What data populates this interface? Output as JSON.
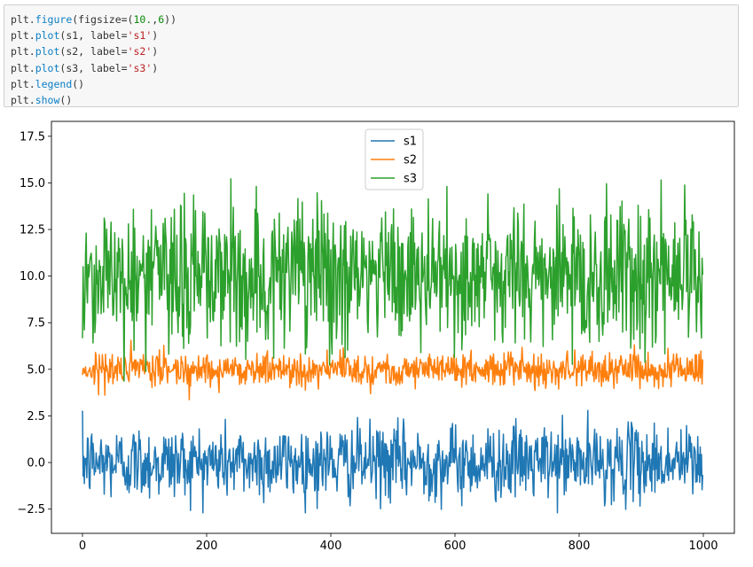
{
  "code_cell": {
    "lines": [
      [
        {
          "t": "plt.",
          "c": "plain"
        },
        {
          "t": "figure",
          "c": "fn"
        },
        {
          "t": "(figsize=(",
          "c": "plain"
        },
        {
          "t": "10.",
          "c": "num"
        },
        {
          "t": ",",
          "c": "plain"
        },
        {
          "t": "6",
          "c": "num"
        },
        {
          "t": "))",
          "c": "plain"
        }
      ],
      [
        {
          "t": "plt.",
          "c": "plain"
        },
        {
          "t": "plot",
          "c": "fn"
        },
        {
          "t": "(s1, label=",
          "c": "plain"
        },
        {
          "t": "'s1'",
          "c": "str"
        },
        {
          "t": ")",
          "c": "plain"
        }
      ],
      [
        {
          "t": "plt.",
          "c": "plain"
        },
        {
          "t": "plot",
          "c": "fn"
        },
        {
          "t": "(s2, label=",
          "c": "plain"
        },
        {
          "t": "'s2'",
          "c": "str"
        },
        {
          "t": ")",
          "c": "plain"
        }
      ],
      [
        {
          "t": "plt.",
          "c": "plain"
        },
        {
          "t": "plot",
          "c": "fn"
        },
        {
          "t": "(s3, label=",
          "c": "plain"
        },
        {
          "t": "'s3'",
          "c": "str"
        },
        {
          "t": ")",
          "c": "plain"
        }
      ],
      [
        {
          "t": "plt.",
          "c": "plain"
        },
        {
          "t": "legend",
          "c": "fn"
        },
        {
          "t": "()",
          "c": "plain"
        }
      ],
      [
        {
          "t": "plt.",
          "c": "plain"
        },
        {
          "t": "show",
          "c": "fn"
        },
        {
          "t": "()",
          "c": "plain"
        }
      ]
    ]
  },
  "colors": {
    "s1": "#1f77b4",
    "s2": "#ff7f0e",
    "s3": "#2ca02c",
    "code_fn": "#0a7ec4",
    "code_num": "#0a8a0a",
    "code_str": "#ba2121"
  },
  "chart_data": {
    "type": "line",
    "title": "",
    "xlabel": "",
    "ylabel": "",
    "xlim": [
      -50,
      1050
    ],
    "ylim": [
      -3.8,
      18.3
    ],
    "xticks": [
      0,
      200,
      400,
      600,
      800,
      1000
    ],
    "xtick_labels": [
      "0",
      "200",
      "400",
      "600",
      "800",
      "1000"
    ],
    "yticks": [
      -2.5,
      0.0,
      2.5,
      5.0,
      7.5,
      10.0,
      12.5,
      15.0,
      17.5
    ],
    "ytick_labels": [
      "−2.5",
      "0.0",
      "2.5",
      "5.0",
      "7.5",
      "10.0",
      "12.5",
      "15.0",
      "17.5"
    ],
    "grid": false,
    "legend_position": "upper center",
    "n_points": 1000,
    "series": [
      {
        "name": "s1",
        "color": "#1f77b4",
        "mean": 0.0,
        "std": 1.0,
        "min": -2.7,
        "max": 3.3
      },
      {
        "name": "s2",
        "color": "#ff7f0e",
        "mean": 5.0,
        "std": 0.45,
        "min": 3.2,
        "max": 6.6
      },
      {
        "name": "s3",
        "color": "#2ca02c",
        "mean": 10.0,
        "std": 2.0,
        "min": 3.1,
        "max": 16.4
      }
    ]
  }
}
